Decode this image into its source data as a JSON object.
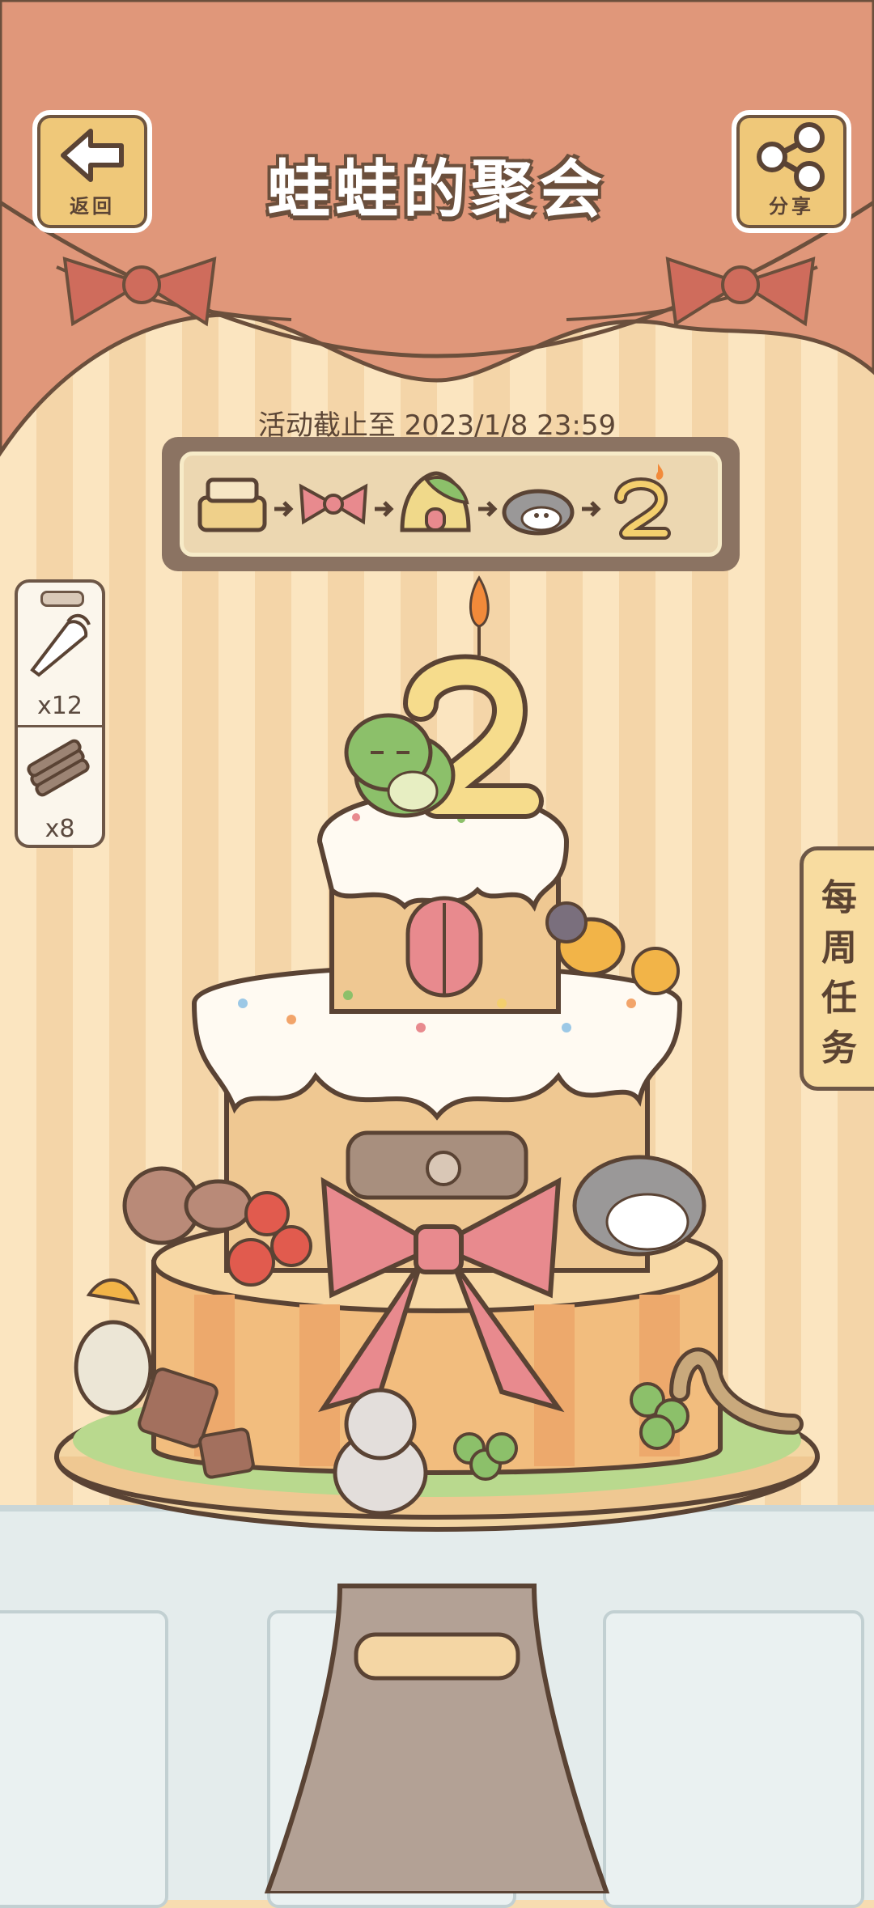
{
  "header": {
    "title": "蛙蛙的聚会",
    "back_label": "返回",
    "share_label": "分享"
  },
  "event": {
    "deadline": "活动截止至 2023/1/8 23:59"
  },
  "progress_steps": [
    "cake-base-icon",
    "ribbon-icon",
    "house-icon",
    "hedgehog-icon",
    "number-two-candle-icon"
  ],
  "inventory": [
    {
      "name": "piping-bag-icon",
      "count": "x12"
    },
    {
      "name": "cookie-sticks-icon",
      "count": "x8"
    }
  ],
  "side_tab": {
    "label": "每周任务"
  },
  "colors": {
    "curtain": "#e0977a",
    "bow": "#cf6c5c",
    "button_bg": "#efc879",
    "outline": "#6b4f3c"
  }
}
